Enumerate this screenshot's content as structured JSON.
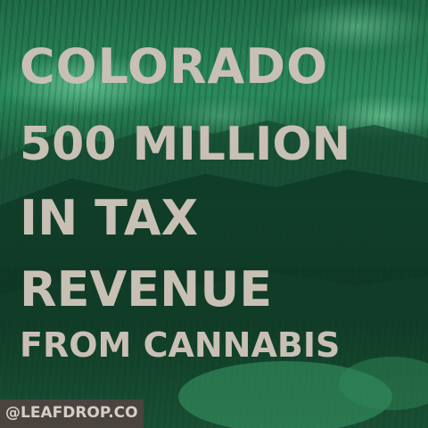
{
  "headline": {
    "line1": "COLORADO",
    "line2": "500 MILLION",
    "line3": "IN TAX",
    "line4": "REVENUE",
    "line5": "FROM CANNABIS"
  },
  "handle": "@LEAFDROP.CO",
  "colors": {
    "text": "#c9c0b5",
    "background_tint": "#1f6b47",
    "handle_bar": "#4a4440"
  }
}
